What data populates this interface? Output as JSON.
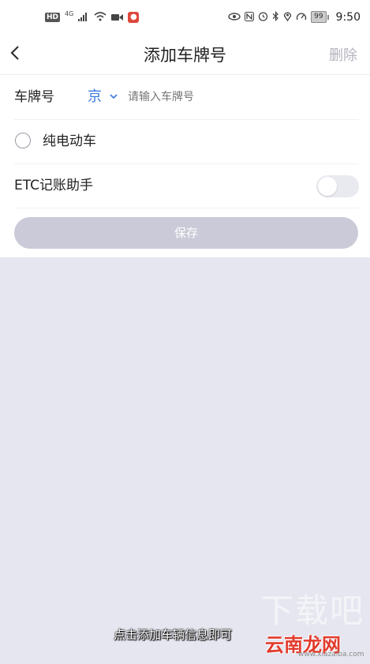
{
  "status_bar": {
    "hd": "HD",
    "network": "4G",
    "battery": "99",
    "time": "9:50"
  },
  "header": {
    "title": "添加车牌号",
    "delete_label": "删除"
  },
  "form": {
    "plate_label": "车牌号",
    "province": "京",
    "plate_placeholder": "请输入车牌号",
    "ev_label": "纯电动车",
    "ev_checked": false,
    "etc_label": "ETC记账助手",
    "etc_on": false
  },
  "save_label": "保存",
  "overlay": {
    "caption": "点击添加车辆信息即可",
    "watermark_large": "下载吧",
    "watermark_logo": "云南龙网",
    "watermark_url": "www.xiazaiba.com"
  },
  "colors": {
    "accent": "#3b7be0",
    "save_disabled": "#cacad8",
    "page_bg": "#e6e6f0"
  }
}
